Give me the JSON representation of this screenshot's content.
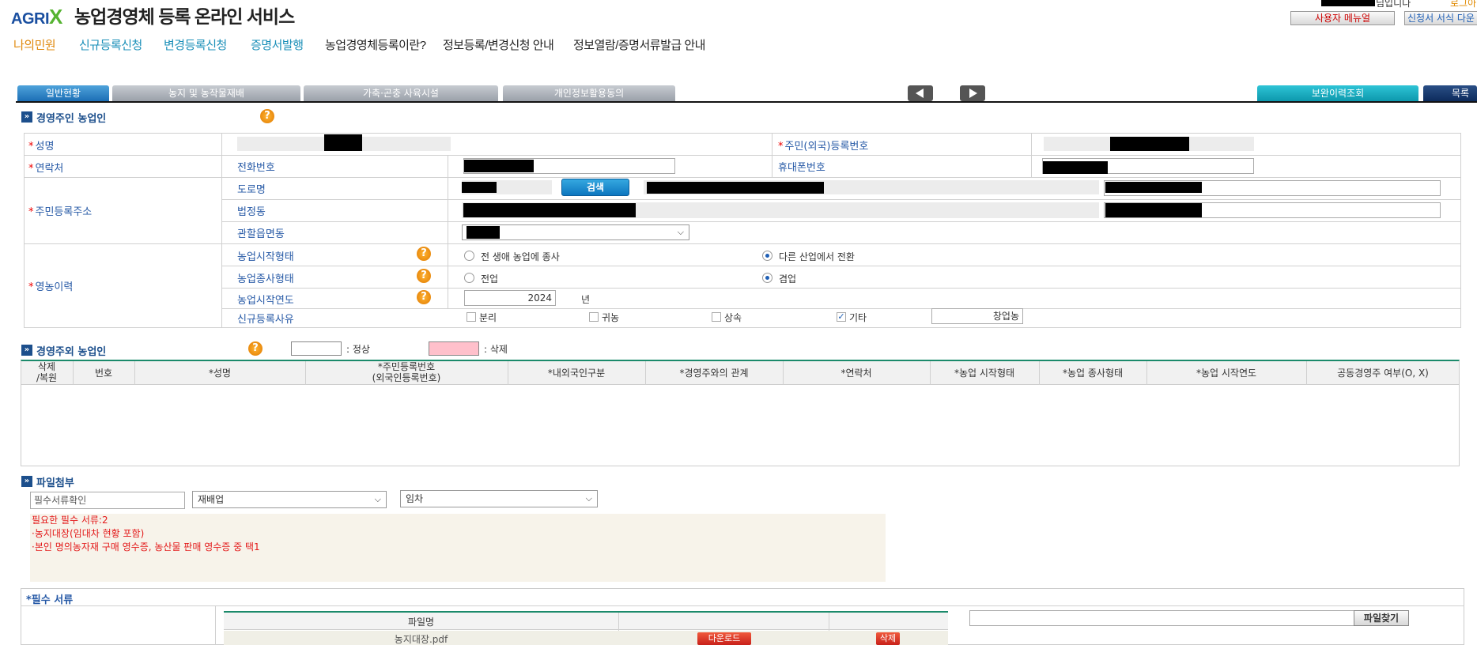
{
  "header": {
    "logo_text": "AGRI",
    "logo_x": "X",
    "site_title": "농업경영체 등록 온라인 서비스",
    "greeting_suffix": "님입니다",
    "logout": "로그아웃",
    "user_menu": "사용자 메뉴얼",
    "form_download": "신청서 서식 다운"
  },
  "nav": {
    "items": [
      "나의민원",
      "신규등록신청",
      "변경등록신청",
      "증명서발행",
      "농업경영체등록이란?",
      "정보등록/변경신청 안내",
      "정보열람/증명서류발급 안내"
    ]
  },
  "tabs": [
    "일반현황",
    "농지 및 농작물재배",
    "가축·곤충 사육시설",
    "개인정보활용동의"
  ],
  "top_buttons": {
    "history": "보완이력조회",
    "list": "목록"
  },
  "section_owner": {
    "title": "경영주인 농업인",
    "name_label": "성명",
    "rrn_label": "주민(외국)등록번호",
    "contact_label": "연락처",
    "phone_label": "전화번호",
    "mobile_label": "휴대폰번호",
    "address_label": "주민등록주소",
    "road_label": "도로명",
    "search_button": "검색",
    "legal_dong_label": "법정동",
    "jurisdiction_label": "관할읍면동",
    "farming_history_label": "영농이력",
    "start_type_label": "농업시작형태",
    "start_type_opt1": "전 생애 농업에 종사",
    "start_type_opt2": "다른 산업에서 전환",
    "work_type_label": "농업종사형태",
    "work_type_opt1": "전업",
    "work_type_opt2": "겸업",
    "start_year_label": "농업시작연도",
    "start_year_value": "2024",
    "year_unit": "년",
    "reason_label": "신규등록사유",
    "reason_opts": [
      "분리",
      "귀농",
      "상속",
      "기타"
    ],
    "reason_other_value": "창업농"
  },
  "section_others": {
    "title": "경영주외 농업인",
    "legend_normal": ": 정상",
    "legend_deleted": ": 삭제",
    "columns": [
      "삭제\n/복원",
      "번호",
      "*성명",
      "*주민등록번호\n(외국인등록번호)",
      "*내외국인구분",
      "*경영주와의 관계",
      "*연락처",
      "*농업 시작형태",
      "*농업 종사형태",
      "*농업 시작연도",
      "공동경영주 여부(O, X)"
    ]
  },
  "section_files": {
    "title": "파일첨부",
    "required_check_placeholder": "필수서류확인",
    "select1": "재배업",
    "select2": "임차",
    "notice_lines": [
      "필요한 필수 서류:2",
      "·농지대장(임대차 현황 포함)",
      "·본인 명의농자재 구매 영수증, 농산물 판매 영수증 중 택1"
    ],
    "required_docs_label": "*필수 서류",
    "file_col": "파일명",
    "file_name": "농지대장.pdf",
    "download": "다운로드",
    "delete": "삭제",
    "find_file": "파일찾기"
  },
  "colors": {
    "accent": "#1c6eb5",
    "nav_orange": "#e0880b",
    "nav_blue": "#1a8fb8",
    "required_red": "#e00000",
    "deleted_pink": "#ffc0cb"
  }
}
